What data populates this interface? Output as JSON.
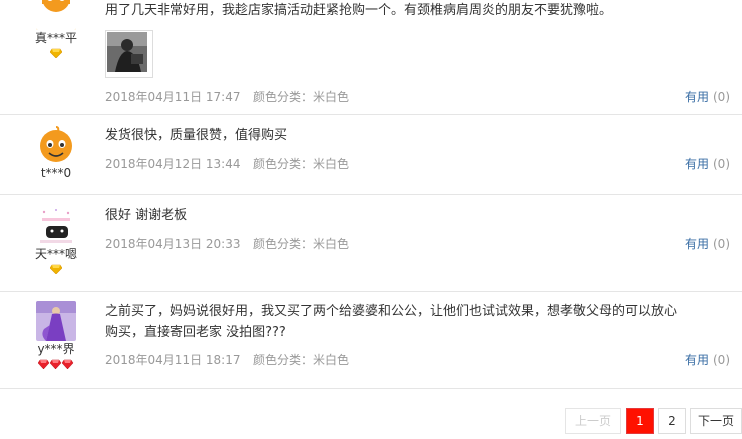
{
  "reviews": [
    {
      "username": "真***平",
      "level_icon": "gold-diamond-icon",
      "content": "用了几天非常好用，我趁店家搞活动赶紧抢购一个。有颈椎病肩周炎的朋友不要犹豫啦。",
      "has_photo": true,
      "date": "2018年04月11日 17:47",
      "attribute": "颜色分类：米白色",
      "useful_label": "有用",
      "useful_count": "(0)"
    },
    {
      "username": "t***0",
      "level_icon": "none",
      "content": "发货很快，质量很赞，值得购买",
      "date": "2018年04月12日 13:44",
      "attribute": "颜色分类：米白色",
      "useful_label": "有用",
      "useful_count": "(0)"
    },
    {
      "username": "天***嗯",
      "level_icon": "gold-diamond-icon",
      "content": "很好 谢谢老板",
      "date": "2018年04月13日 20:33",
      "attribute": "颜色分类：米白色",
      "useful_label": "有用",
      "useful_count": "(0)"
    },
    {
      "username": "y***界",
      "level_icon": "three-red-diamonds-icon",
      "content_line1": "之前买了，妈妈说很好用，我又买了两个给婆婆和公公，让他们也试试效果，想孝敬父母的可以放心",
      "content_line2": "购买，直接寄回老家 没拍图???",
      "date": "2018年04月11日 18:17",
      "attribute": "颜色分类：米白色",
      "useful_label": "有用",
      "useful_count": "(0)"
    }
  ],
  "pagination": {
    "prev_label": "上一页",
    "pages": [
      "1",
      "2"
    ],
    "current_page": "1",
    "next_label": "下一页"
  },
  "colors": {
    "accent": "#ff2a00",
    "link": "#3a6ea5",
    "meta": "#999999",
    "divider": "#e5e5e5"
  }
}
